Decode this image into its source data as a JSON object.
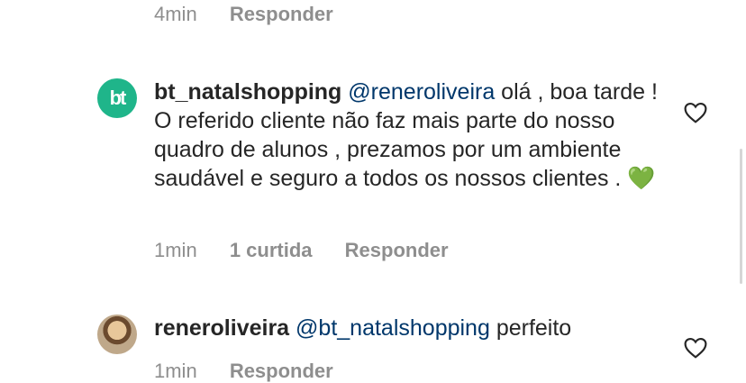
{
  "top_comment": {
    "time": "4min",
    "reply_label": "Responder"
  },
  "comments": [
    {
      "username": "bt_natalshopping",
      "avatar_text": "bt",
      "mention": "@reneroliveira",
      "body": " olá , boa tarde ! O referido cliente não faz mais parte do nosso quadro de alunos , prezamos por um ambiente saudável e seguro a todos os nossos clientes . 💚",
      "time": "1min",
      "likes": "1 curtida",
      "reply_label": "Responder"
    },
    {
      "username": "reneroliveira",
      "mention": "@bt_natalshopping",
      "body": " perfeito",
      "time": "1min",
      "reply_label": "Responder"
    }
  ],
  "colors": {
    "brand_avatar": "#1fb58a",
    "mention": "#00376b",
    "meta": "#8e8e8e"
  },
  "icons": [
    "heart-outline-icon"
  ]
}
